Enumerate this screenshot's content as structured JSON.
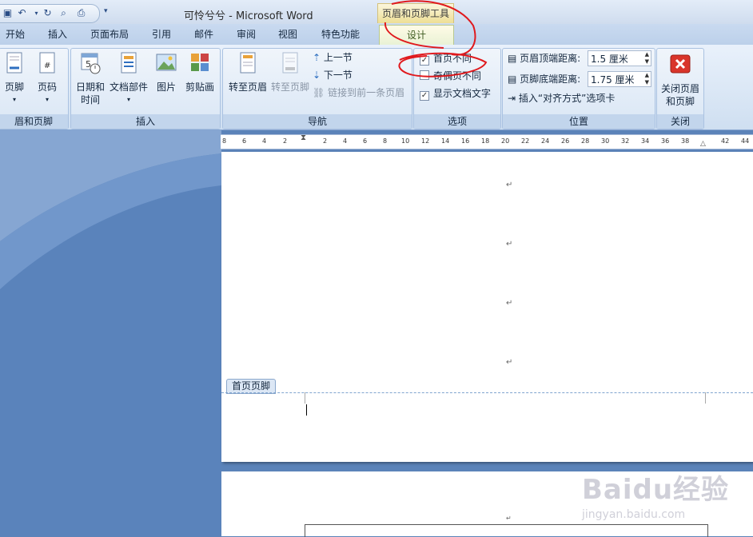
{
  "window": {
    "title": "可怜兮兮 - Microsoft Word",
    "context_tab": "页眉和页脚工具"
  },
  "tabs": [
    {
      "label": "开始"
    },
    {
      "label": "插入"
    },
    {
      "label": "页面布局"
    },
    {
      "label": "引用"
    },
    {
      "label": "邮件"
    },
    {
      "label": "审阅"
    },
    {
      "label": "视图"
    },
    {
      "label": "特色功能"
    },
    {
      "label": "设计"
    }
  ],
  "ribbon": {
    "header_footer": {
      "label": "眉和页脚",
      "footer_btn": "页脚",
      "page_num_btn": "页码"
    },
    "insert": {
      "label": "插入",
      "datetime_line1": "日期和",
      "datetime_line2": "时间",
      "docparts": "文档部件",
      "picture": "图片",
      "clipart": "剪贴画"
    },
    "nav": {
      "label": "导航",
      "goto_header": "转至页眉",
      "goto_footer": "转至页脚",
      "prev": "上一节",
      "next": "下一节",
      "link_prev": "链接到前一条页眉"
    },
    "options": {
      "label": "选项",
      "diff_first": "首页不同",
      "diff_odd_even": "奇偶页不同",
      "show_text": "显示文档文字",
      "diff_first_checked": true,
      "diff_odd_even_checked": false,
      "show_text_checked": true
    },
    "position": {
      "label": "位置",
      "header_top": "页眉顶端距离:",
      "header_val": "1.5 厘米",
      "footer_bottom": "页脚底端距离:",
      "footer_val": "1.75 厘米",
      "insert_align": "插入“对齐方式”选项卡"
    },
    "close": {
      "label": "关闭",
      "btn_line1": "关闭页眉",
      "btn_line2": "和页脚"
    }
  },
  "ruler": [
    "8",
    "6",
    "4",
    "2",
    "2",
    "4",
    "6",
    "8",
    "10",
    "12",
    "14",
    "16",
    "18",
    "20",
    "22",
    "24",
    "26",
    "28",
    "30",
    "32",
    "34",
    "36",
    "38",
    "42",
    "44"
  ],
  "document": {
    "para_mark": "↵",
    "footer_tag": "首页页脚"
  },
  "watermark": {
    "brand": "Baidu经验",
    "url": "jingyan.baidu.com"
  },
  "colors": {
    "annotation_red": "#e0191d",
    "accent": "#5b83b9"
  }
}
